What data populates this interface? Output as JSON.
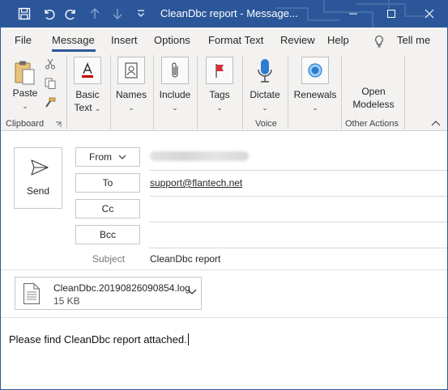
{
  "window": {
    "title": "CleanDbc report  -  Message..."
  },
  "tabs": [
    "File",
    "Message",
    "Insert",
    "Options",
    "Format Text",
    "Review",
    "Help"
  ],
  "tell_me": "Tell me",
  "ribbon": {
    "paste": "Paste",
    "basic_text_1": "Basic",
    "basic_text_2": "Text",
    "names": "Names",
    "include": "Include",
    "tags": "Tags",
    "dictate": "Dictate",
    "renewals": "Renewals",
    "open_modeless_1": "Open",
    "open_modeless_2": "Modeless",
    "groups": {
      "clipboard": "Clipboard",
      "voice": "Voice",
      "other_actions": "Other Actions"
    }
  },
  "compose": {
    "send": "Send",
    "from_label": "From",
    "to_label": "To",
    "cc_label": "Cc",
    "bcc_label": "Bcc",
    "subject_label": "Subject",
    "to_value": "support@flantech.net",
    "subject_value": "CleanDbc report"
  },
  "attachment": {
    "name": "CleanDbc.20190826090854.log",
    "size": "15 KB"
  },
  "body": {
    "text": "Please find CleanDbc report attached."
  },
  "colors": {
    "titlebar": "#2b579a",
    "ribbon_bg": "#f3f2f1",
    "accent": "#2b579a"
  }
}
